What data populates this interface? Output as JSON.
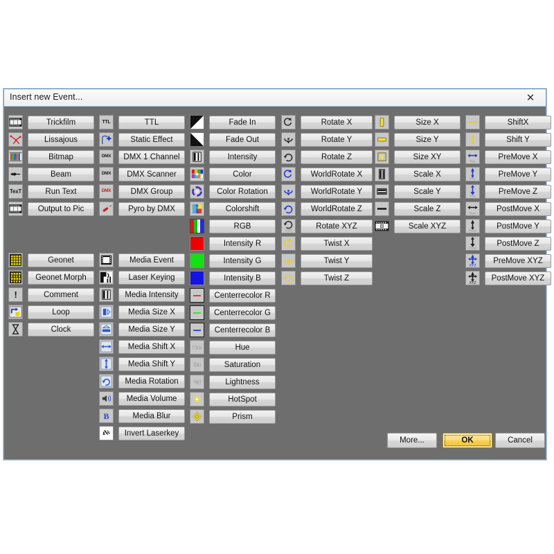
{
  "window": {
    "title": "Insert new Event...",
    "close_label": "✕",
    "bg_color": "#6e6e6e",
    "border_color": "#7f9db9"
  },
  "footer": {
    "more_label": "More...",
    "ok_label": "OK",
    "cancel_label": "Cancel",
    "ok_accent_color": "#f3c63e"
  },
  "columns": [
    {
      "id": "col-generators",
      "groups": [
        {
          "id": "grp-generators",
          "items": [
            {
              "label": "Trickfilm",
              "icon": "filmstrip-icon"
            },
            {
              "label": "Lissajous",
              "icon": "lissajous-icon"
            },
            {
              "label": "Bitmap",
              "icon": "bitmap-bars-icon"
            },
            {
              "label": "Beam",
              "icon": "beam-arrow-icon"
            },
            {
              "label": "Run Text",
              "icon": "text-icon"
            },
            {
              "label": "Output to Pic",
              "icon": "filmstrip-icon"
            }
          ]
        },
        {
          "id": "grp-misc",
          "items": [
            {
              "label": "Geonet",
              "icon": "geonet-grid-icon"
            },
            {
              "label": "Geonet Morph",
              "icon": "geonet-morph-icon"
            },
            {
              "label": "Comment",
              "icon": "exclamation-icon"
            },
            {
              "label": "Loop",
              "icon": "loop-icon"
            },
            {
              "label": "Clock",
              "icon": "hourglass-icon"
            }
          ]
        }
      ]
    },
    {
      "id": "col-dmx",
      "groups": [
        {
          "id": "grp-dmx",
          "items": [
            {
              "label": "TTL",
              "icon": "ttl-icon"
            },
            {
              "label": "Static Effect",
              "icon": "static-effect-icon"
            },
            {
              "label": "DMX 1 Channel",
              "icon": "dmx-icon"
            },
            {
              "label": "DMX Scanner",
              "icon": "dmx-icon"
            },
            {
              "label": "DMX Group",
              "icon": "dmx-red-icon"
            },
            {
              "label": "Pyro by DMX",
              "icon": "pyro-icon"
            }
          ]
        },
        {
          "id": "grp-media",
          "items": [
            {
              "label": "Media Event",
              "icon": "media-film-icon"
            },
            {
              "label": "Laser Keying",
              "icon": "laser-keying-icon"
            },
            {
              "label": "Media Intensity",
              "icon": "intensity-bar-icon"
            },
            {
              "label": "Media Size X",
              "icon": "size-x-icon"
            },
            {
              "label": "Media Size Y",
              "icon": "size-y-icon"
            },
            {
              "label": "Media Shift X",
              "icon": "shift-x-icon"
            },
            {
              "label": "Media Shift Y",
              "icon": "shift-y-icon"
            },
            {
              "label": "Media Rotation",
              "icon": "rotation-icon"
            },
            {
              "label": "Media Volume",
              "icon": "speaker-icon"
            },
            {
              "label": "Media Blur",
              "icon": "blur-b-icon"
            },
            {
              "label": "Invert Laserkey",
              "icon": "invert-icon"
            }
          ]
        }
      ]
    },
    {
      "id": "col-color",
      "groups": [
        {
          "id": "grp-color",
          "items": [
            {
              "label": "Fade In",
              "icon": "fade-in-icon"
            },
            {
              "label": "Fade Out",
              "icon": "fade-out-icon"
            },
            {
              "label": "Intensity",
              "icon": "intensity-bar-icon"
            },
            {
              "label": "Color",
              "icon": "color-palette-icon"
            },
            {
              "label": "Color Rotation",
              "icon": "color-wheel-icon"
            },
            {
              "label": "Colorshift",
              "icon": "colorshift-icon"
            },
            {
              "label": "RGB",
              "icon": "rgb-bars-icon"
            },
            {
              "label": "Intensity R",
              "icon": "swatch-red-icon"
            },
            {
              "label": "Intensity G",
              "icon": "swatch-green-icon"
            },
            {
              "label": "Intensity B",
              "icon": "swatch-blue-icon"
            },
            {
              "label": "Centerrecolor R",
              "icon": "centerrecolor-r-icon"
            },
            {
              "label": "Centerrecolor G",
              "icon": "centerrecolor-g-icon"
            },
            {
              "label": "Centerrecolor B",
              "icon": "centerrecolor-b-icon"
            },
            {
              "label": "Hue",
              "icon": "hue-icon"
            },
            {
              "label": "Saturation",
              "icon": "sat-icon"
            },
            {
              "label": "Lightness",
              "icon": "val-icon"
            },
            {
              "label": "HotSpot",
              "icon": "hotspot-icon"
            },
            {
              "label": "Prism",
              "icon": "prism-icon"
            }
          ]
        }
      ]
    },
    {
      "id": "col-rotate",
      "groups": [
        {
          "id": "grp-rotate",
          "items": [
            {
              "label": "Rotate X",
              "icon": "rotate-x-icon"
            },
            {
              "label": "Rotate Y",
              "icon": "rotate-y-icon"
            },
            {
              "label": "Rotate Z",
              "icon": "rotate-z-icon"
            },
            {
              "label": "WorldRotate X",
              "icon": "worldrotate-x-icon"
            },
            {
              "label": "WorldRotate Y",
              "icon": "worldrotate-y-icon"
            },
            {
              "label": "WorldRotate Z",
              "icon": "worldrotate-z-icon"
            },
            {
              "label": "Rotate XYZ",
              "icon": "rotate-xyz-icon"
            },
            {
              "label": "Twist X",
              "icon": "twist-x-icon"
            },
            {
              "label": "Twist Y",
              "icon": "twist-y-icon"
            },
            {
              "label": "Twist Z",
              "icon": "twist-z-icon"
            }
          ]
        }
      ]
    },
    {
      "id": "col-size",
      "groups": [
        {
          "id": "grp-size",
          "items": [
            {
              "label": "Size X",
              "icon": "size-x-yellow-icon"
            },
            {
              "label": "Size Y",
              "icon": "size-y-yellow-icon"
            },
            {
              "label": "Size XY",
              "icon": "size-xy-yellow-icon"
            },
            {
              "label": "Scale X",
              "icon": "scale-x-icon"
            },
            {
              "label": "Scale Y",
              "icon": "scale-y-icon"
            },
            {
              "label": "Scale Z",
              "icon": "scale-z-icon"
            },
            {
              "label": "Scale XYZ",
              "icon": "scale-xyz-icon"
            }
          ]
        }
      ]
    },
    {
      "id": "col-move",
      "groups": [
        {
          "id": "grp-move",
          "items": [
            {
              "label": "ShiftX",
              "icon": "shift-x-yellow-icon"
            },
            {
              "label": "Shift Y",
              "icon": "shift-y-yellow-icon"
            },
            {
              "label": "PreMove X",
              "icon": "premove-x-icon"
            },
            {
              "label": "PreMove Y",
              "icon": "premove-y-icon"
            },
            {
              "label": "PreMove Z",
              "icon": "premove-z-icon"
            },
            {
              "label": "PostMove X",
              "icon": "postmove-x-icon"
            },
            {
              "label": "PostMove Y",
              "icon": "postmove-y-icon"
            },
            {
              "label": "PostMove Z",
              "icon": "postmove-z-icon"
            },
            {
              "label": "PreMove XYZ",
              "icon": "premove-xyz-icon"
            },
            {
              "label": "PostMove XYZ",
              "icon": "postmove-xyz-icon"
            }
          ]
        }
      ]
    }
  ]
}
